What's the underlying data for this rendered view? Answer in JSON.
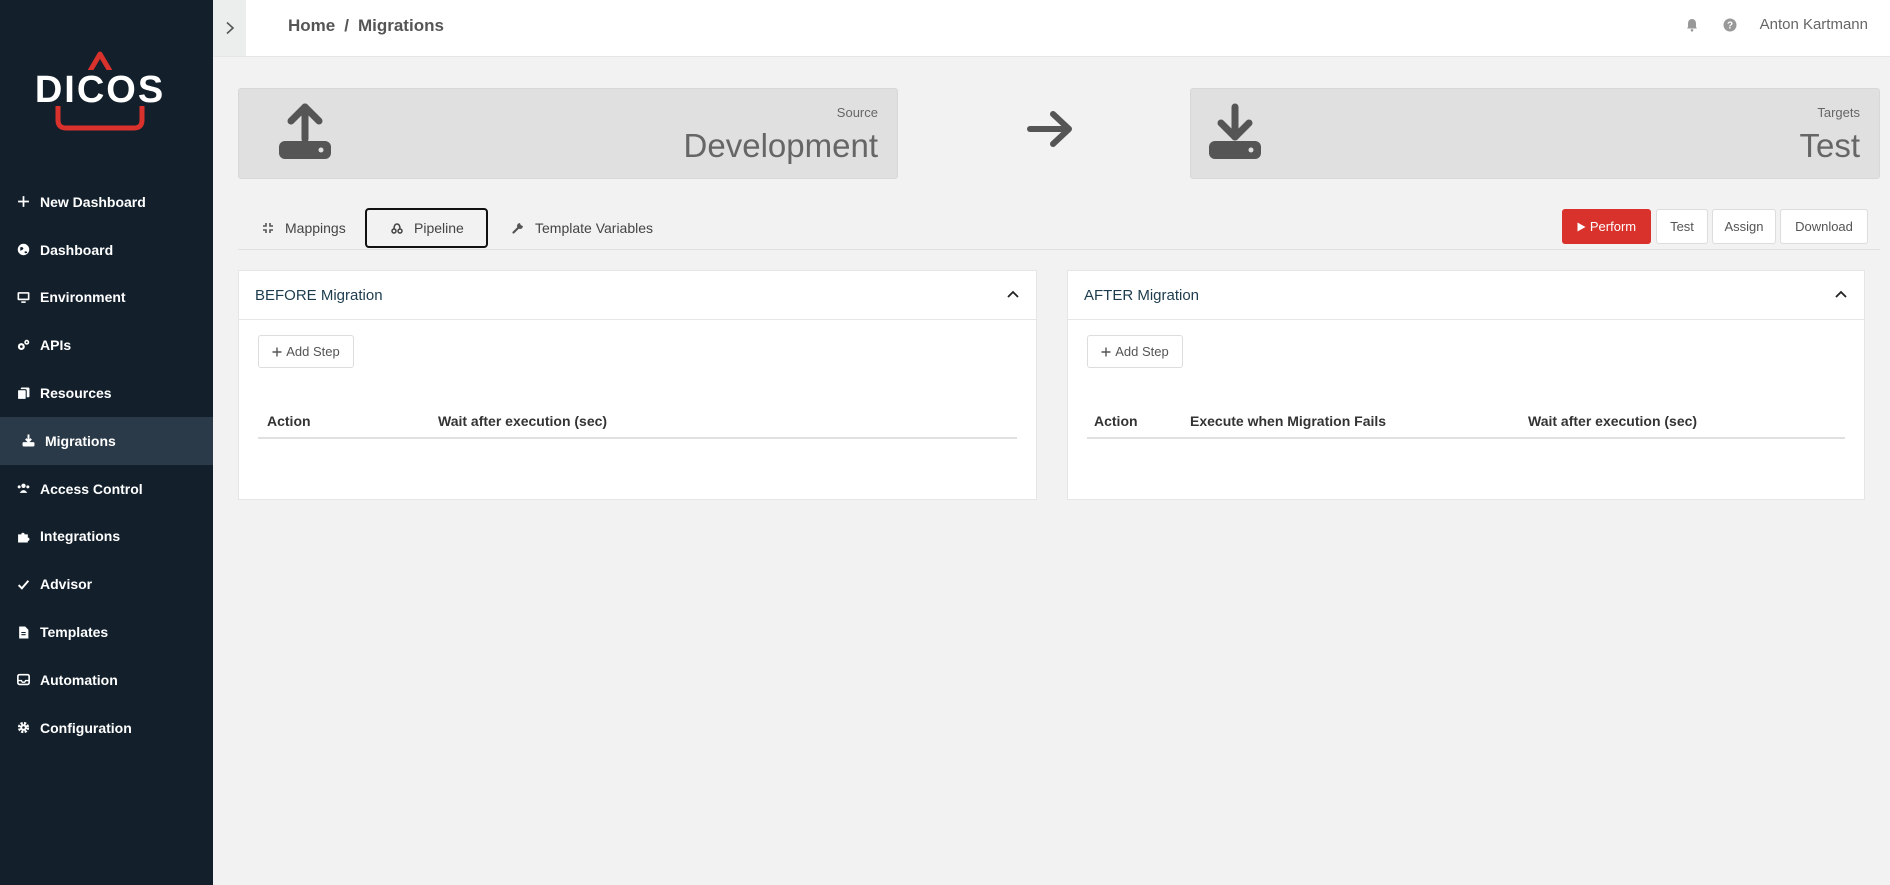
{
  "app": {
    "logo_text": "DICOS",
    "accent_color": "#d9312b",
    "sidebar_bg": "#13202c"
  },
  "sidebar": {
    "items": [
      {
        "label": "New Dashboard",
        "icon": "plus-icon"
      },
      {
        "label": "Dashboard",
        "icon": "globe-icon"
      },
      {
        "label": "Environment",
        "icon": "monitor-icon"
      },
      {
        "label": "APIs",
        "icon": "cogs-icon"
      },
      {
        "label": "Resources",
        "icon": "copy-icon"
      },
      {
        "label": "Migrations",
        "icon": "download-icon",
        "active": true
      },
      {
        "label": "Access Control",
        "icon": "users-icon"
      },
      {
        "label": "Integrations",
        "icon": "puzzle-icon"
      },
      {
        "label": "Advisor",
        "icon": "check-icon"
      },
      {
        "label": "Templates",
        "icon": "file-icon"
      },
      {
        "label": "Automation",
        "icon": "inbox-icon"
      },
      {
        "label": "Configuration",
        "icon": "gear-icon"
      }
    ]
  },
  "header": {
    "breadcrumb": [
      "Home",
      "Migrations"
    ],
    "separator": "/",
    "user": "Anton Kartmann"
  },
  "source": {
    "label": "Source",
    "value": "Development"
  },
  "target": {
    "label": "Targets",
    "value": "Test"
  },
  "tabs": [
    {
      "label": "Mappings",
      "icon": "compress-icon"
    },
    {
      "label": "Pipeline",
      "icon": "pipeline-icon",
      "active": true
    },
    {
      "label": "Template Variables",
      "icon": "wrench-icon"
    }
  ],
  "actions": {
    "perform": "Perform",
    "test": "Test",
    "assign": "Assign",
    "download": "Download"
  },
  "before_panel": {
    "title": "BEFORE Migration",
    "add_step": "Add Step",
    "columns": [
      "Action",
      "Wait after execution (sec)"
    ]
  },
  "after_panel": {
    "title": "AFTER Migration",
    "add_step": "Add Step",
    "columns": [
      "Action",
      "Execute when Migration Fails",
      "Wait after execution (sec)"
    ]
  }
}
